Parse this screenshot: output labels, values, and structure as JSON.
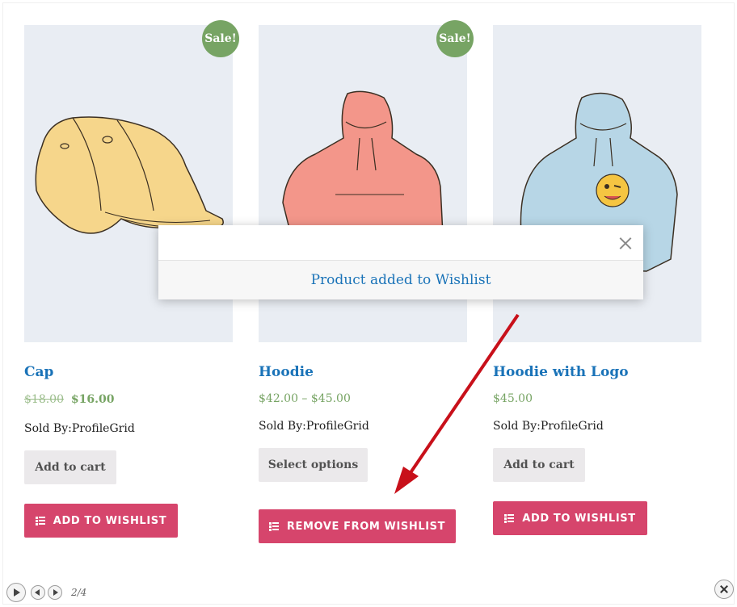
{
  "products": [
    {
      "name": "Cap",
      "sale_badge": "Sale!",
      "price_old": "$18.00",
      "price": "$16.00",
      "sold_by": "Sold By:ProfileGrid",
      "cart_button": "Add to cart",
      "wishlist_button": "ADD TO WISHLIST",
      "image": "cap-illustration"
    },
    {
      "name": "Hoodie",
      "sale_badge": "Sale!",
      "price": "$42.00 – $45.00",
      "sold_by": "Sold By:ProfileGrid",
      "cart_button": "Select options",
      "wishlist_button": "REMOVE FROM WISHLIST",
      "image": "pink-hoodie-illustration"
    },
    {
      "name": "Hoodie with Logo",
      "price": "$45.00",
      "sold_by": "Sold By:ProfileGrid",
      "cart_button": "Add to cart",
      "wishlist_button": "ADD TO WISHLIST",
      "image": "blue-hoodie-with-emoji-illustration"
    }
  ],
  "modal": {
    "message": "Product added to Wishlist",
    "close_icon": "close-icon"
  },
  "player": {
    "counter": "2/4"
  },
  "colors": {
    "title": "#1a73b8",
    "price": "#77a464",
    "wishlist_button": "#d6456c",
    "sale_badge": "#77a464",
    "arrow": "#c8101a"
  }
}
